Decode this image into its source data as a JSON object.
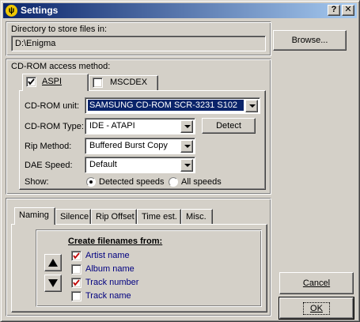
{
  "window": {
    "title": "Settings",
    "help_button": "?",
    "close_button": "✕",
    "title_icon": "ψ"
  },
  "directory": {
    "label": "Directory to store files in:",
    "value": "D:\\Enigma",
    "browse_label": "Browse..."
  },
  "cdrom": {
    "group_label": "CD-ROM access method:",
    "tabs": [
      {
        "label": "ASPI",
        "checked": true,
        "active": true
      },
      {
        "label": "MSCDEX",
        "checked": false,
        "active": false
      }
    ],
    "unit_label": "CD-ROM unit:",
    "unit_value": "SAMSUNG CD-ROM SCR-3231 S102",
    "type_label": "CD-ROM Type:",
    "type_value": "IDE  - ATAPI",
    "detect_label": "Detect",
    "rip_label": "Rip Method:",
    "rip_value": "Buffered Burst Copy",
    "dae_label": "DAE Speed:",
    "dae_value": "Default",
    "show_label": "Show:",
    "show_options": [
      {
        "label": "Detected speeds",
        "selected": true
      },
      {
        "label": "All speeds",
        "selected": false
      }
    ]
  },
  "naming": {
    "tabs": [
      {
        "label": "Naming",
        "active": true
      },
      {
        "label": "Silence",
        "active": false
      },
      {
        "label": "Rip Offset",
        "active": false
      },
      {
        "label": "Time est.",
        "active": false
      },
      {
        "label": "Misc.",
        "active": false
      }
    ],
    "heading": "Create filenames from:",
    "items": [
      {
        "label": "Artist name",
        "checked": true
      },
      {
        "label": "Album name",
        "checked": false
      },
      {
        "label": "Track number",
        "checked": true
      },
      {
        "label": "Track name",
        "checked": false
      }
    ]
  },
  "footer": {
    "cancel_label": "Cancel",
    "ok_label": "OK"
  },
  "colors": {
    "titlebar_start": "#0a246a",
    "titlebar_end": "#a6caf0",
    "selection": "#0a246a",
    "check_mark": "#c00000",
    "item_text": "#000080"
  }
}
